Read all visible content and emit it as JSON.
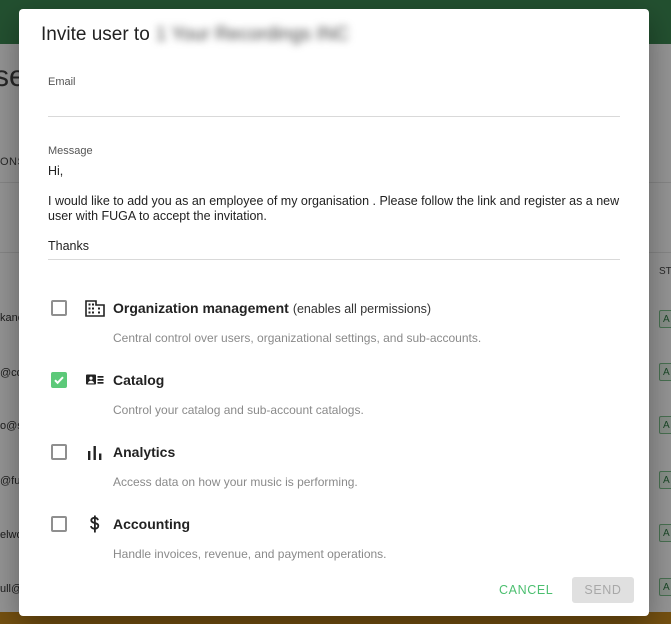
{
  "background": {
    "heading": "se",
    "column_label": "ONS",
    "status_column": "STA",
    "emails": [
      "kane",
      "@cdb",
      "o@s",
      "@fu",
      "elwo",
      "ull@"
    ],
    "badge": "A"
  },
  "dialog": {
    "title": "Invite user to",
    "org_name": "1 Your Recordings INC",
    "email_label": "Email",
    "email_value": "",
    "message_label": "Message",
    "message_value": "Hi,\n\nI would like to add you as an employee of my organisation . Please follow the link and register as a new user with FUGA to accept the invitation.\n\nThanks",
    "permissions": [
      {
        "title": "Organization management",
        "note": "(enables all permissions)",
        "description": "Central control over users, organizational settings, and sub-accounts.",
        "icon": "building-icon",
        "checked": false
      },
      {
        "title": "Catalog",
        "note": "",
        "description": "Control your catalog and sub-account catalogs.",
        "icon": "catalog-card-icon",
        "checked": true
      },
      {
        "title": "Analytics",
        "note": "",
        "description": "Access data on how your music is performing.",
        "icon": "bar-chart-icon",
        "checked": false
      },
      {
        "title": "Accounting",
        "note": "",
        "description": "Handle invoices, revenue, and payment operations.",
        "icon": "dollar-icon",
        "checked": false
      }
    ],
    "cancel_label": "CANCEL",
    "send_label": "SEND"
  },
  "colors": {
    "accent": "#5cc979",
    "cancel_text": "#4cbf70",
    "top_bar": "#3d8b54"
  }
}
